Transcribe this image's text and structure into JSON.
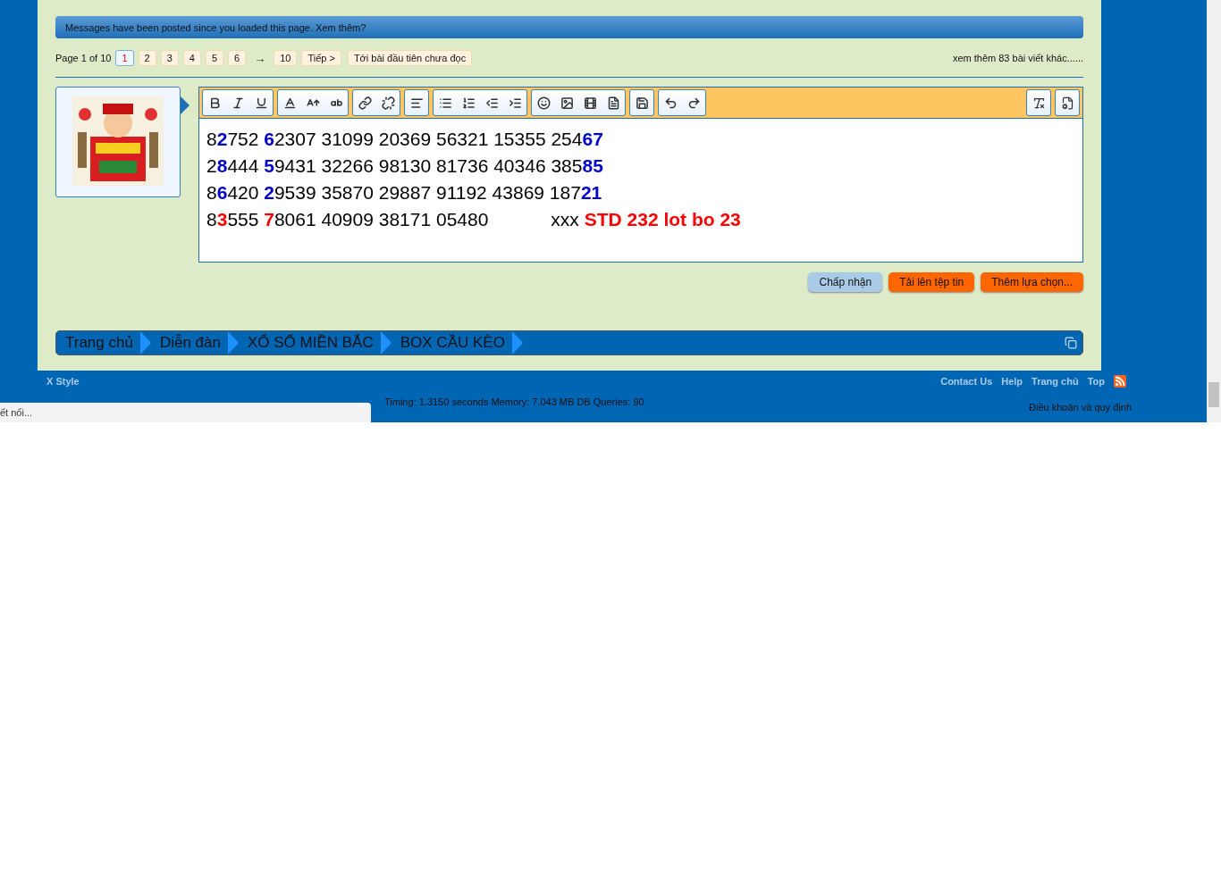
{
  "notice": {
    "text": "Messages have been posted since you loaded this page. Xem thêm?"
  },
  "pagination": {
    "label": "Page 1 of 10",
    "pages": [
      {
        "label": "1",
        "selected": true
      },
      {
        "label": "2",
        "selected": false
      },
      {
        "label": "3",
        "selected": false
      },
      {
        "label": "4",
        "selected": false
      },
      {
        "label": "5",
        "selected": false
      },
      {
        "label": "6",
        "selected": false
      }
    ],
    "arrow": "→",
    "last": "10",
    "next": "Tiếp >",
    "unread": "Tới bài đầu tiên chưa đọc",
    "more": "xem thêm 83 bài viết khác......"
  },
  "editor": {
    "lines": [
      [
        {
          "text": "8",
          "color": "#000000",
          "bold": false
        },
        {
          "text": "2",
          "color": "#0000cc",
          "bold": true
        },
        {
          "text": "752 ",
          "color": "#000000",
          "bold": false
        },
        {
          "text": "6",
          "color": "#0000cc",
          "bold": true
        },
        {
          "text": "2307 31099 20369 56321 15355 254",
          "color": "#000000",
          "bold": false
        },
        {
          "text": "67",
          "color": "#0000cc",
          "bold": true
        }
      ],
      [
        {
          "text": "2",
          "color": "#000000",
          "bold": false
        },
        {
          "text": "8",
          "color": "#0000cc",
          "bold": true
        },
        {
          "text": "444 ",
          "color": "#000000",
          "bold": false
        },
        {
          "text": "5",
          "color": "#0000cc",
          "bold": true
        },
        {
          "text": "9431 32266 98130 81736 40346 385",
          "color": "#000000",
          "bold": false
        },
        {
          "text": "85",
          "color": "#0000cc",
          "bold": true
        }
      ],
      [
        {
          "text": "8",
          "color": "#000000",
          "bold": false
        },
        {
          "text": "6",
          "color": "#0000cc",
          "bold": true
        },
        {
          "text": "420 ",
          "color": "#000000",
          "bold": false
        },
        {
          "text": "2",
          "color": "#0000cc",
          "bold": true
        },
        {
          "text": "9539 35870 29887 91192 43869 187",
          "color": "#000000",
          "bold": false
        },
        {
          "text": "21",
          "color": "#0000cc",
          "bold": true
        }
      ],
      [
        {
          "text": "8",
          "color": "#000000",
          "bold": false
        },
        {
          "text": "3",
          "color": "#ff0000",
          "bold": true
        },
        {
          "text": "555 ",
          "color": "#000000",
          "bold": false
        },
        {
          "text": "7",
          "color": "#ff0000",
          "bold": true
        },
        {
          "text": "8061 40909 38171 05480            xxx ",
          "color": "#000000",
          "bold": false
        },
        {
          "text": "STD 232 lot bo 23",
          "color": "#ff0000",
          "bold": true
        }
      ]
    ]
  },
  "buttons": [
    {
      "label": "Chấp nhận",
      "kind": "primary"
    },
    {
      "label": "Tải lên tệp tin",
      "kind": "secondary"
    },
    {
      "label": "Thêm lựa chọn...",
      "kind": "secondary"
    }
  ],
  "breadcrumbs": [
    "Trang chủ",
    "Diễn đàn",
    "XỔ SỐ MIỀN BẮC",
    "BOX CẦU KÈO"
  ],
  "footer": {
    "style": "X Style",
    "links": [
      "Contact Us",
      "Help",
      "Trang chủ",
      "Top"
    ],
    "timing": "Timing: 1.3150 seconds Memory: 7.043 MB DB Queries: 90",
    "terms": "Điều khoản và quy định"
  },
  "status_bar": {
    "text": "ết nối..."
  }
}
